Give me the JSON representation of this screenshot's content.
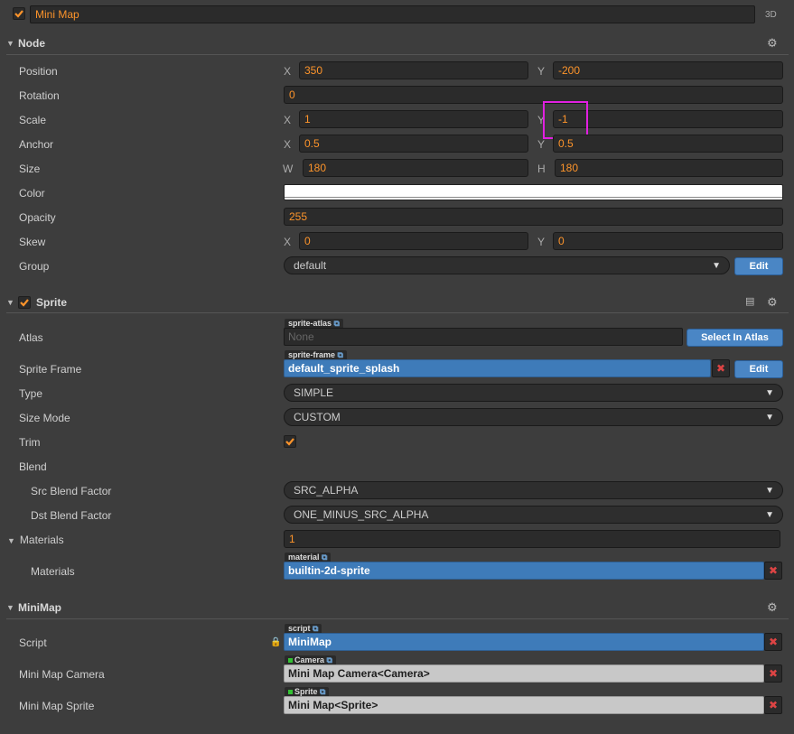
{
  "header": {
    "node_name": "Mini Map",
    "mode_label": "3D",
    "enabled": true
  },
  "node": {
    "title": "Node",
    "position": {
      "label": "Position",
      "x": "350",
      "y": "-200"
    },
    "rotation": {
      "label": "Rotation",
      "value": "0"
    },
    "scale": {
      "label": "Scale",
      "x": "1",
      "y": "-1"
    },
    "anchor": {
      "label": "Anchor",
      "x": "0.5",
      "y": "0.5"
    },
    "size": {
      "label": "Size",
      "w": "180",
      "h": "180"
    },
    "color": {
      "label": "Color",
      "value": "#ffffff"
    },
    "opacity": {
      "label": "Opacity",
      "value": "255"
    },
    "skew": {
      "label": "Skew",
      "x": "0",
      "y": "0"
    },
    "group": {
      "label": "Group",
      "value": "default",
      "edit_label": "Edit"
    },
    "axis_labels": {
      "x": "X",
      "y": "Y",
      "w": "W",
      "h": "H"
    }
  },
  "sprite": {
    "title": "Sprite",
    "enabled": true,
    "atlas": {
      "label": "Atlas",
      "tag": "sprite-atlas",
      "value": "None",
      "button": "Select In Atlas"
    },
    "sprite_frame": {
      "label": "Sprite Frame",
      "tag": "sprite-frame",
      "value": "default_sprite_splash",
      "button": "Edit"
    },
    "type": {
      "label": "Type",
      "value": "SIMPLE"
    },
    "size_mode": {
      "label": "Size Mode",
      "value": "CUSTOM"
    },
    "trim": {
      "label": "Trim",
      "checked": true
    },
    "blend": {
      "label": "Blend"
    },
    "src_blend": {
      "label": "Src Blend Factor",
      "value": "SRC_ALPHA"
    },
    "dst_blend": {
      "label": "Dst Blend Factor",
      "value": "ONE_MINUS_SRC_ALPHA"
    },
    "materials_count": {
      "label": "Materials",
      "value": "1"
    },
    "materials": {
      "label": "Materials",
      "tag": "material",
      "value": "builtin-2d-sprite"
    }
  },
  "minimap": {
    "title": "MiniMap",
    "script": {
      "label": "Script",
      "tag": "script",
      "value": "MiniMap"
    },
    "camera": {
      "label": "Mini Map Camera",
      "tag": "Camera",
      "value": "Mini Map Camera<Camera>"
    },
    "sprite": {
      "label": "Mini Map Sprite",
      "tag": "Sprite",
      "value": "Mini Map<Sprite>"
    }
  },
  "colors": {
    "accent": "#fd942b",
    "highlight": "#e020e0",
    "button_blue": "#4a86c5"
  }
}
